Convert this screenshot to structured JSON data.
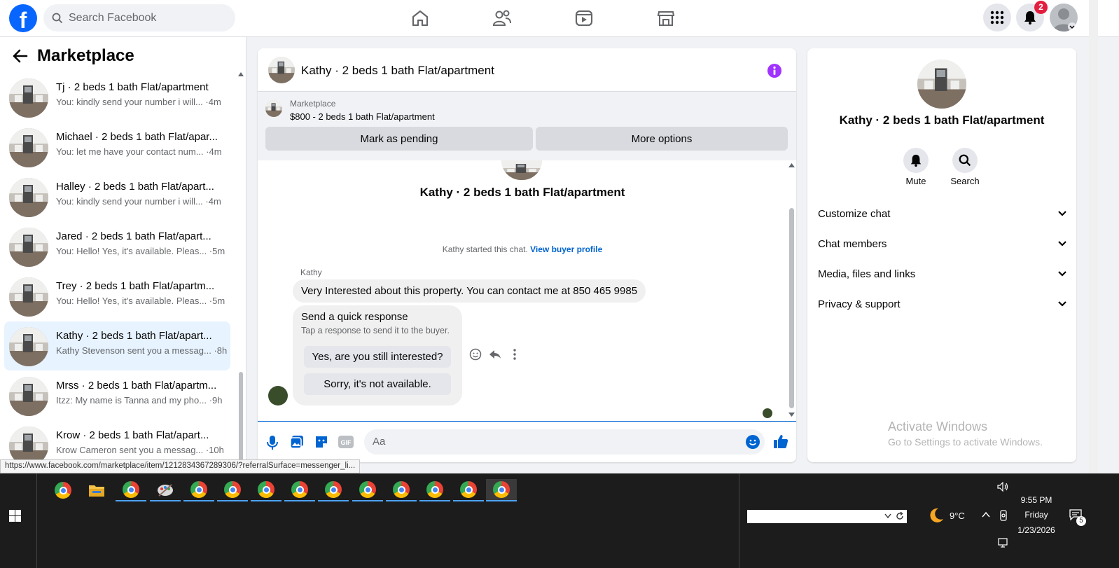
{
  "topnav": {
    "logo_letter": "f",
    "search_placeholder": "Search Facebook",
    "notification_count": "2"
  },
  "sidebar": {
    "title": "Marketplace",
    "conversations": [
      {
        "name": "Tj · 2 beds 1 bath Flat/apartment",
        "preview": "You: kindly send your number i will... ·4m"
      },
      {
        "name": "Michael · 2 beds 1 bath Flat/apar...",
        "preview": "You: let me have your contact num... ·4m"
      },
      {
        "name": "Halley · 2 beds 1 bath Flat/apart...",
        "preview": "You: kindly send your number i will... ·4m"
      },
      {
        "name": "Jared · 2 beds 1 bath Flat/apart...",
        "preview": "You: Hello! Yes, it's available. Pleas... ·5m"
      },
      {
        "name": "Trey · 2 beds 1 bath Flat/apartm...",
        "preview": "You: Hello! Yes, it's available. Pleas... ·5m"
      },
      {
        "name": "Kathy · 2 beds 1 bath Flat/apart...",
        "preview": "Kathy Stevenson sent you a messag... ·8h"
      },
      {
        "name": "Mrss · 2 beds 1 bath Flat/apartm...",
        "preview": "Itzz: My name is Tanna and my pho... ·9h"
      },
      {
        "name": "Krow · 2 beds 1 bath Flat/apart...",
        "preview": "Krow Cameron sent you a messag... ·10h"
      }
    ],
    "active_index": 5
  },
  "status_url": "https://www.facebook.com/marketplace/item/1212834367289306/?referralSurface=messenger_li...",
  "chat": {
    "title": "Kathy · 2 beds 1 bath Flat/apartment",
    "marketplace_label": "Marketplace",
    "listing": "$800 - 2 beds 1 bath Flat/apartment",
    "mark_pending_label": "Mark as pending",
    "more_options_label": "More options",
    "center_title": "Kathy · 2 beds 1 bath Flat/apartment",
    "started_text": "Kathy started this chat.",
    "view_profile_link": "View buyer profile",
    "sender_name": "Kathy",
    "message_text": "Very Interested about this property. You can contact me at 850 465 9985",
    "quick_response": {
      "title": "Send a quick response",
      "subtitle": "Tap a response to send it to the buyer.",
      "options": [
        "Yes, are you still interested?",
        "Sorry, it's not available."
      ]
    },
    "composer_placeholder": "Aa"
  },
  "info_panel": {
    "name": "Kathy · 2 beds 1 bath Flat/apartment",
    "actions": [
      {
        "label": "Mute",
        "icon": "bell-icon"
      },
      {
        "label": "Search",
        "icon": "search-icon"
      }
    ],
    "sections": [
      "Customize chat",
      "Chat members",
      "Media, files and links",
      "Privacy & support"
    ],
    "watermark_title": "Activate Windows",
    "watermark_sub": "Go to Settings to activate Windows."
  },
  "taskbar": {
    "weather": "9°C",
    "time": "9:55 PM",
    "day": "Friday",
    "date": "1/23/2026",
    "notification_count": "5"
  },
  "colors": {
    "facebook_blue": "#0866ff",
    "link_blue": "#0064d1",
    "badge_red": "#e41e3f",
    "info_purple": "#a033ff"
  }
}
